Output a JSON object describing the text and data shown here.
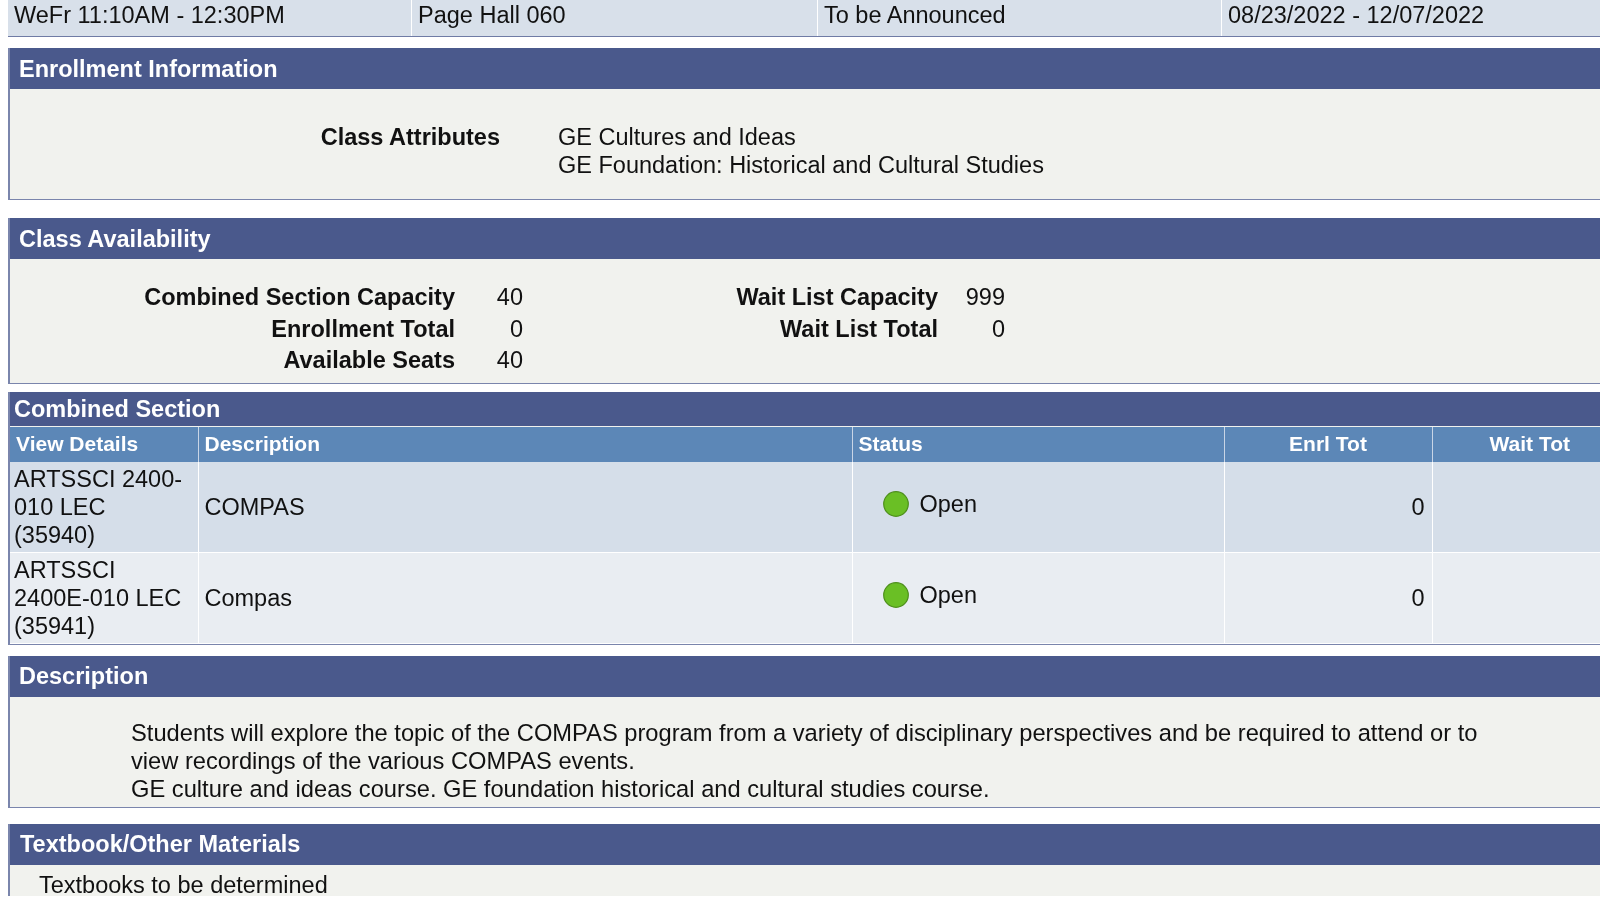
{
  "meeting_row": {
    "cells": [
      "WeFr 11:10AM - 12:30PM",
      "Page Hall 060",
      "To be Announced",
      "08/23/2022 - 12/07/2022"
    ]
  },
  "enrollment_information": {
    "title": "Enrollment Information",
    "fields": [
      {
        "label": "Class Attributes",
        "values": [
          "GE Cultures and Ideas",
          "GE Foundation: Historical and Cultural Studies"
        ]
      }
    ]
  },
  "class_availability": {
    "title": "Class Availability",
    "columns": [
      {
        "fields": [
          {
            "label": "Combined Section Capacity",
            "value": "40"
          },
          {
            "label": "Enrollment Total",
            "value": "0"
          },
          {
            "label": "Available Seats",
            "value": "40"
          }
        ]
      },
      {
        "fields": [
          {
            "label": "Wait List Capacity",
            "value": "999"
          },
          {
            "label": "Wait List Total",
            "value": "0"
          }
        ]
      }
    ]
  },
  "combined_section": {
    "title": "Combined Section",
    "columns": [
      "View Details",
      "Description",
      "Status",
      "Enrl Tot",
      "Wait Tot"
    ],
    "rows": [
      {
        "section": "ARTSSCI 2400-010 LEC (35940)",
        "description": "COMPAS",
        "status": {
          "label": "Open",
          "color": "#6abf25"
        },
        "enrl_tot": "0"
      },
      {
        "section": "ARTSSCI 2400E-010 LEC (35941)",
        "description": "Compas",
        "status": {
          "label": "Open",
          "color": "#6abf25"
        },
        "enrl_tot": "0"
      }
    ]
  },
  "description": {
    "title": "Description",
    "paragraphs": [
      "Students will explore the topic of the COMPAS program from a variety of disciplinary perspectives and be required to attend or to view recordings of the various COMPAS events.",
      "GE culture and ideas course. GE foundation historical and cultural studies course."
    ]
  },
  "textbook_other_materials": {
    "title": "Textbook/Other Materials",
    "text": "Textbooks to be determined"
  }
}
